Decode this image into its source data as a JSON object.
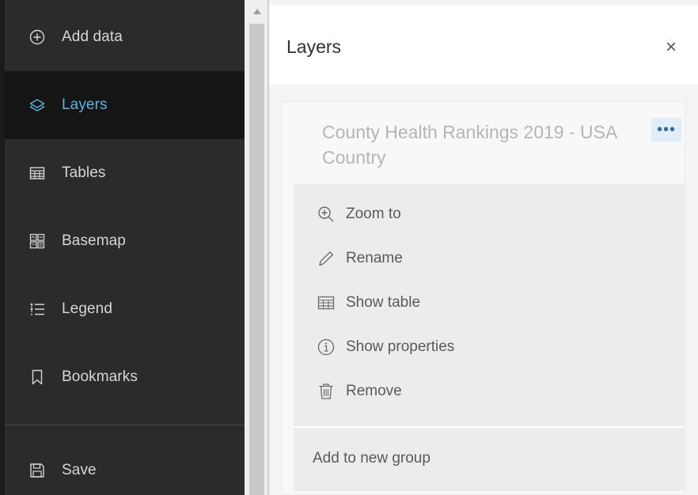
{
  "sidebar": {
    "items": [
      {
        "label": "Add data",
        "icon": "plus-circle-icon"
      },
      {
        "label": "Layers",
        "icon": "layers-icon",
        "active": true
      },
      {
        "label": "Tables",
        "icon": "table-icon"
      },
      {
        "label": "Basemap",
        "icon": "basemap-icon"
      },
      {
        "label": "Legend",
        "icon": "legend-icon"
      },
      {
        "label": "Bookmarks",
        "icon": "bookmark-icon"
      }
    ],
    "save": {
      "label": "Save",
      "icon": "save-icon"
    }
  },
  "panel": {
    "title": "Layers",
    "close_symbol": "×",
    "layer": {
      "name": "County Health Rankings 2019 - USA Country",
      "more_symbol": "•••"
    },
    "menu": {
      "items": [
        {
          "label": "Zoom to",
          "icon": "zoom-in-icon"
        },
        {
          "label": "Rename",
          "icon": "pencil-icon"
        },
        {
          "label": "Show table",
          "icon": "table-icon"
        },
        {
          "label": "Show properties",
          "icon": "info-icon"
        },
        {
          "label": "Remove",
          "icon": "trash-icon"
        }
      ],
      "group_label": "Add to new group"
    }
  },
  "colors": {
    "sidebar_bg": "#2b2b2b",
    "sidebar_active_bg": "#151515",
    "accent": "#5bb4de",
    "panel_bg": "#f4f4f4",
    "menu_bg": "#ececec"
  }
}
